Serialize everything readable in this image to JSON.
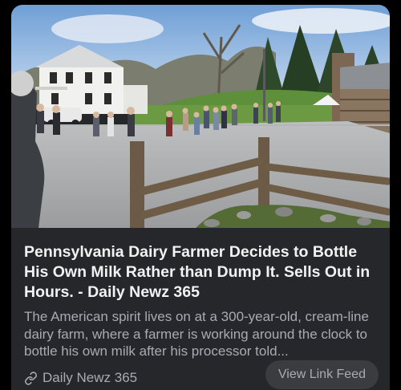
{
  "card": {
    "image_alt": "",
    "title": "Pennsylvania Dairy Farmer Decides to Bottle His Own Milk Rather than Dump It. Sells Out in Hours. - Daily Newz 365",
    "description": "The American spirit lives on at a 300-year-old, cream-line dairy farm, where a farmer is working around the clock to bottle his own milk after his processor told...",
    "source_name": "Daily Newz 365",
    "source_icon": "link-icon",
    "action_label": "View Link Feed"
  },
  "colors": {
    "card_bg": "#25272b",
    "title": "#f2f2f2",
    "muted_text": "#a9abb0",
    "button_bg": "#3a3c40"
  }
}
